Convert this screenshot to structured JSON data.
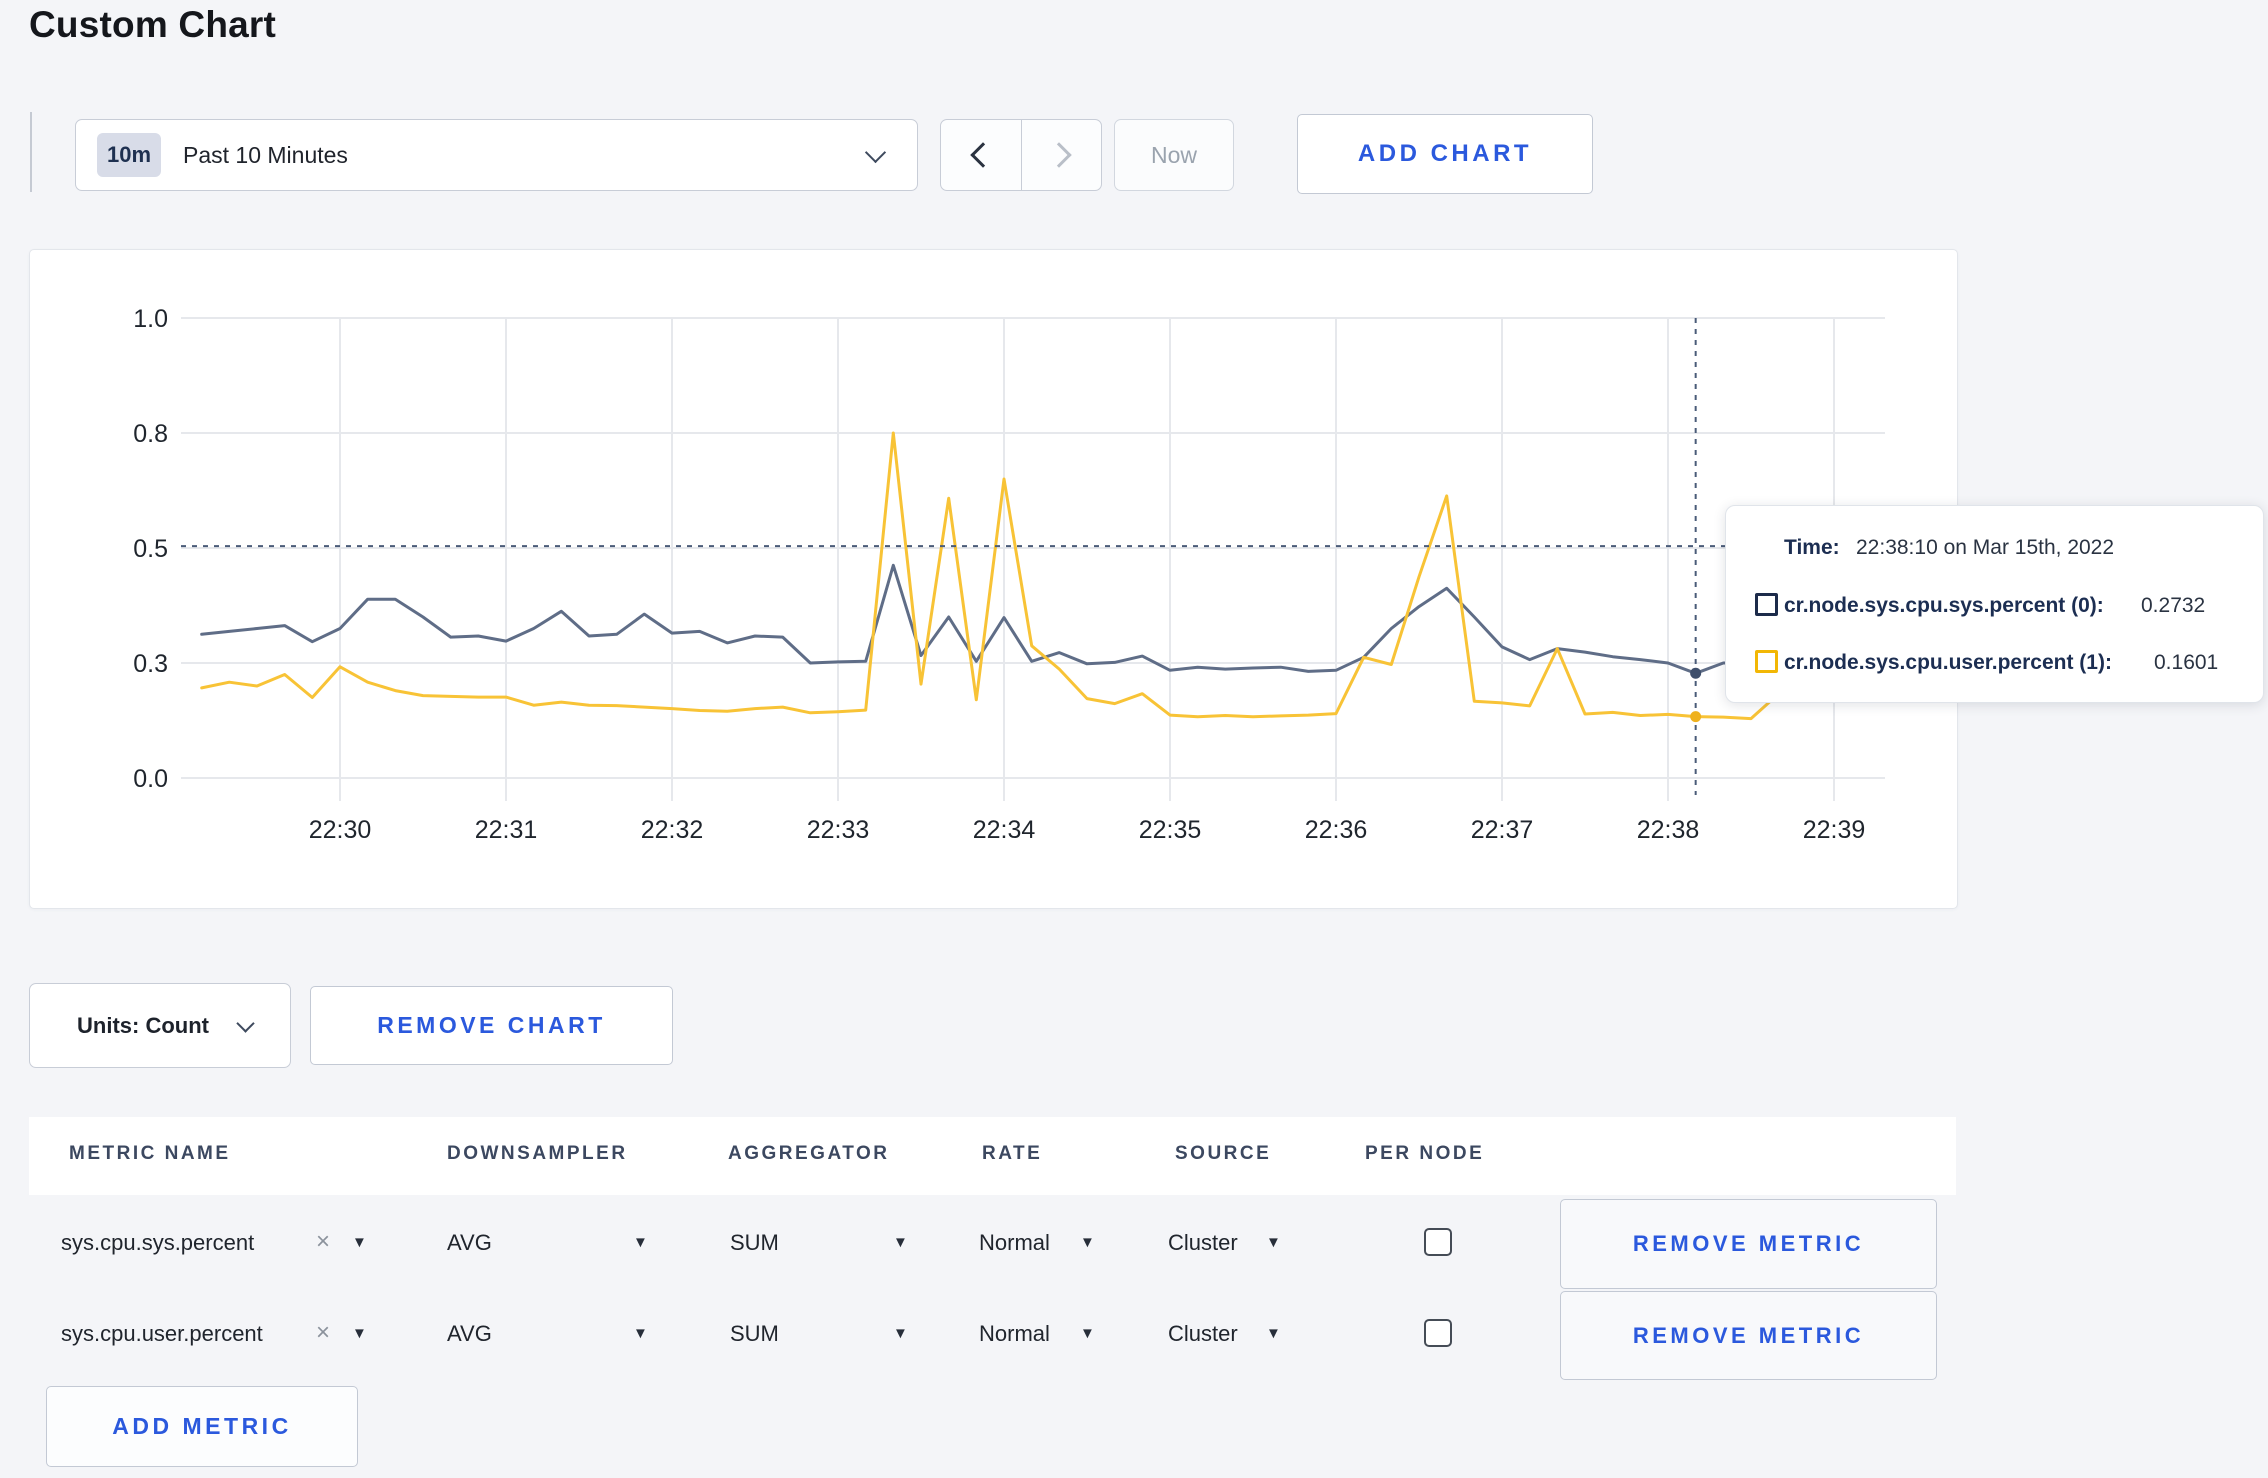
{
  "page": {
    "title": "Custom Chart"
  },
  "colors": {
    "accent_blue": "#2b59dd",
    "series_sys": "#5f6d87",
    "series_user": "#f8c336",
    "sys_dot": "#3f4f6c",
    "user_dot": "#efb11d",
    "crosshair": "#4a5b78",
    "grid": "#e6e8ec"
  },
  "icons": {
    "caret_down": "▼",
    "close": "×"
  },
  "toolbar": {
    "time_range_badge": "10m",
    "time_range_label": "Past 10 Minutes",
    "now_label": "Now",
    "add_chart_label": "ADD CHART"
  },
  "chart_data": {
    "type": "line",
    "title": "",
    "xlabel": "",
    "ylabel": "",
    "x_unit": "seconds relative to 22:30:00, Mar 15th 2022",
    "x_tick_labels": [
      "22:30",
      "22:31",
      "22:32",
      "22:33",
      "22:34",
      "22:35",
      "22:36",
      "22:37",
      "22:38",
      "22:39"
    ],
    "y_ticks": [
      0.0,
      0.3,
      0.5,
      0.8,
      1.0
    ],
    "y_tick_labels": [
      "0.0",
      "0.3",
      "0.5",
      "0.8",
      "1.0"
    ],
    "grid": true,
    "legend_position": "tooltip-only",
    "series": [
      {
        "name": "cr.node.sys.cpu.sys.percent (0)",
        "color": "#5f6d87",
        "points": [
          [
            -50,
            0.35
          ],
          [
            -40,
            0.355
          ],
          [
            -30,
            0.36
          ],
          [
            -20,
            0.365
          ],
          [
            -10,
            0.337
          ],
          [
            0,
            0.36
          ],
          [
            10,
            0.411
          ],
          [
            20,
            0.411
          ],
          [
            30,
            0.38
          ],
          [
            40,
            0.345
          ],
          [
            50,
            0.347
          ],
          [
            60,
            0.338
          ],
          [
            70,
            0.36
          ],
          [
            80,
            0.39
          ],
          [
            90,
            0.347
          ],
          [
            100,
            0.35
          ],
          [
            110,
            0.385
          ],
          [
            120,
            0.352
          ],
          [
            130,
            0.355
          ],
          [
            140,
            0.335
          ],
          [
            150,
            0.347
          ],
          [
            160,
            0.345
          ],
          [
            170,
            0.3
          ],
          [
            180,
            0.302
          ],
          [
            190,
            0.303
          ],
          [
            200,
            0.47
          ],
          [
            210,
            0.313
          ],
          [
            220,
            0.38
          ],
          [
            230,
            0.303
          ],
          [
            240,
            0.379
          ],
          [
            250,
            0.303
          ],
          [
            260,
            0.318
          ],
          [
            270,
            0.298
          ],
          [
            280,
            0.301
          ],
          [
            290,
            0.312
          ],
          [
            300,
            0.281
          ],
          [
            310,
            0.289
          ],
          [
            320,
            0.284
          ],
          [
            330,
            0.287
          ],
          [
            340,
            0.289
          ],
          [
            350,
            0.278
          ],
          [
            360,
            0.281
          ],
          [
            370,
            0.31
          ],
          [
            380,
            0.36
          ],
          [
            390,
            0.398
          ],
          [
            400,
            0.43
          ],
          [
            410,
            0.38
          ],
          [
            420,
            0.328
          ],
          [
            430,
            0.306
          ],
          [
            440,
            0.325
          ],
          [
            450,
            0.319
          ],
          [
            460,
            0.311
          ],
          [
            470,
            0.306
          ],
          [
            480,
            0.3
          ],
          [
            490,
            0.2732
          ],
          [
            500,
            0.3
          ],
          [
            510,
            0.3
          ],
          [
            520,
            0.31
          ],
          [
            530,
            0.3
          ],
          [
            540,
            0.305
          ],
          [
            550,
            0.3
          ]
        ]
      },
      {
        "name": "cr.node.sys.cpu.user.percent (1)",
        "color": "#f8c336",
        "points": [
          [
            -50,
            0.235
          ],
          [
            -40,
            0.25
          ],
          [
            -30,
            0.24
          ],
          [
            -20,
            0.27
          ],
          [
            -10,
            0.21
          ],
          [
            0,
            0.29
          ],
          [
            10,
            0.25
          ],
          [
            20,
            0.228
          ],
          [
            30,
            0.215
          ],
          [
            40,
            0.213
          ],
          [
            50,
            0.211
          ],
          [
            60,
            0.211
          ],
          [
            70,
            0.19
          ],
          [
            80,
            0.198
          ],
          [
            90,
            0.19
          ],
          [
            100,
            0.189
          ],
          [
            110,
            0.185
          ],
          [
            120,
            0.181
          ],
          [
            130,
            0.176
          ],
          [
            140,
            0.174
          ],
          [
            150,
            0.181
          ],
          [
            160,
            0.185
          ],
          [
            170,
            0.17
          ],
          [
            180,
            0.173
          ],
          [
            190,
            0.177
          ],
          [
            200,
            0.8
          ],
          [
            210,
            0.245
          ],
          [
            220,
            0.63
          ],
          [
            230,
            0.204
          ],
          [
            240,
            0.68
          ],
          [
            250,
            0.33
          ],
          [
            260,
            0.284
          ],
          [
            270,
            0.207
          ],
          [
            280,
            0.194
          ],
          [
            290,
            0.22
          ],
          [
            300,
            0.164
          ],
          [
            310,
            0.16
          ],
          [
            320,
            0.163
          ],
          [
            330,
            0.16
          ],
          [
            340,
            0.162
          ],
          [
            350,
            0.164
          ],
          [
            360,
            0.168
          ],
          [
            370,
            0.31
          ],
          [
            380,
            0.296
          ],
          [
            390,
            0.45
          ],
          [
            400,
            0.636
          ],
          [
            410,
            0.2
          ],
          [
            420,
            0.196
          ],
          [
            430,
            0.188
          ],
          [
            440,
            0.325
          ],
          [
            450,
            0.167
          ],
          [
            460,
            0.171
          ],
          [
            470,
            0.163
          ],
          [
            480,
            0.166
          ],
          [
            490,
            0.1601
          ],
          [
            500,
            0.159
          ],
          [
            510,
            0.155
          ],
          [
            520,
            0.22
          ],
          [
            530,
            0.27
          ],
          [
            540,
            0.274
          ],
          [
            550,
            0.23
          ]
        ]
      }
    ],
    "crosshair": {
      "t": 490,
      "time": "22:38:10",
      "hline_value": 0.505
    }
  },
  "tooltip": {
    "time_label": "Time:",
    "time_value": "22:38:10 on Mar 15th, 2022",
    "entries": [
      {
        "label": "cr.node.sys.cpu.sys.percent (0):",
        "value": "0.2732",
        "swatch_color": "#1c2b4a"
      },
      {
        "label": "cr.node.sys.cpu.user.percent (1):",
        "value": "0.1601",
        "swatch_color": "#f2b705"
      }
    ]
  },
  "controls": {
    "units_label": "Units: Count",
    "remove_chart_label": "REMOVE CHART",
    "add_metric_label": "ADD METRIC"
  },
  "metrics_table": {
    "columns": [
      "METRIC NAME",
      "DOWNSAMPLER",
      "AGGREGATOR",
      "RATE",
      "SOURCE",
      "PER NODE"
    ],
    "rows": [
      {
        "name": "sys.cpu.sys.percent",
        "downsampler": "AVG",
        "aggregator": "SUM",
        "rate": "Normal",
        "source": "Cluster",
        "per_node_checked": false,
        "remove_label": "REMOVE METRIC"
      },
      {
        "name": "sys.cpu.user.percent",
        "downsampler": "AVG",
        "aggregator": "SUM",
        "rate": "Normal",
        "source": "Cluster",
        "per_node_checked": false,
        "remove_label": "REMOVE METRIC"
      }
    ]
  }
}
